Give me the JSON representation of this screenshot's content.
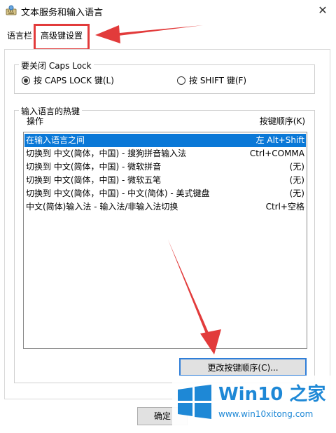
{
  "window": {
    "title": "文本服务和输入语言",
    "close_glyph": "✕"
  },
  "tabs": [
    {
      "label": "语言栏"
    },
    {
      "label": "高级键设置"
    }
  ],
  "caps_lock": {
    "legend": "要关闭 Caps Lock",
    "option_caps": "按 CAPS LOCK 键(L)",
    "option_shift": "按 SHIFT 键(F)",
    "selected": "option_caps"
  },
  "hotkeys": {
    "legend": "输入语言的热键",
    "col_action": "操作",
    "col_order": "按键顺序(K)",
    "rows": [
      {
        "action": "在输入语言之间",
        "keys": "左 Alt+Shift",
        "selected": true
      },
      {
        "action": "切换到 中文(简体，中国) - 搜狗拼音输入法",
        "keys": "Ctrl+COMMA"
      },
      {
        "action": "切换到 中文(简体，中国) - 微软拼音",
        "keys": "(无)"
      },
      {
        "action": "切换到 中文(简体，中国) - 微软五笔",
        "keys": "(无)"
      },
      {
        "action": "切换到 中文(简体，中国) - 中文(简体) - 美式键盘",
        "keys": "(无)"
      },
      {
        "action": "中文(简体)输入法 - 输入法/非输入法切换",
        "keys": "Ctrl+空格"
      }
    ],
    "change_button": "更改按键顺序(C)..."
  },
  "footer": {
    "ok_button": "确定"
  },
  "watermark": {
    "brand": "Win10 之家",
    "url": "www.win10xitong.com"
  },
  "colors": {
    "selection": "#0a78d7",
    "annotation": "#e23b3b",
    "brand": "#1e88d6"
  },
  "icons": {
    "app": "keyboard-globe-icon",
    "close": "close-icon"
  }
}
